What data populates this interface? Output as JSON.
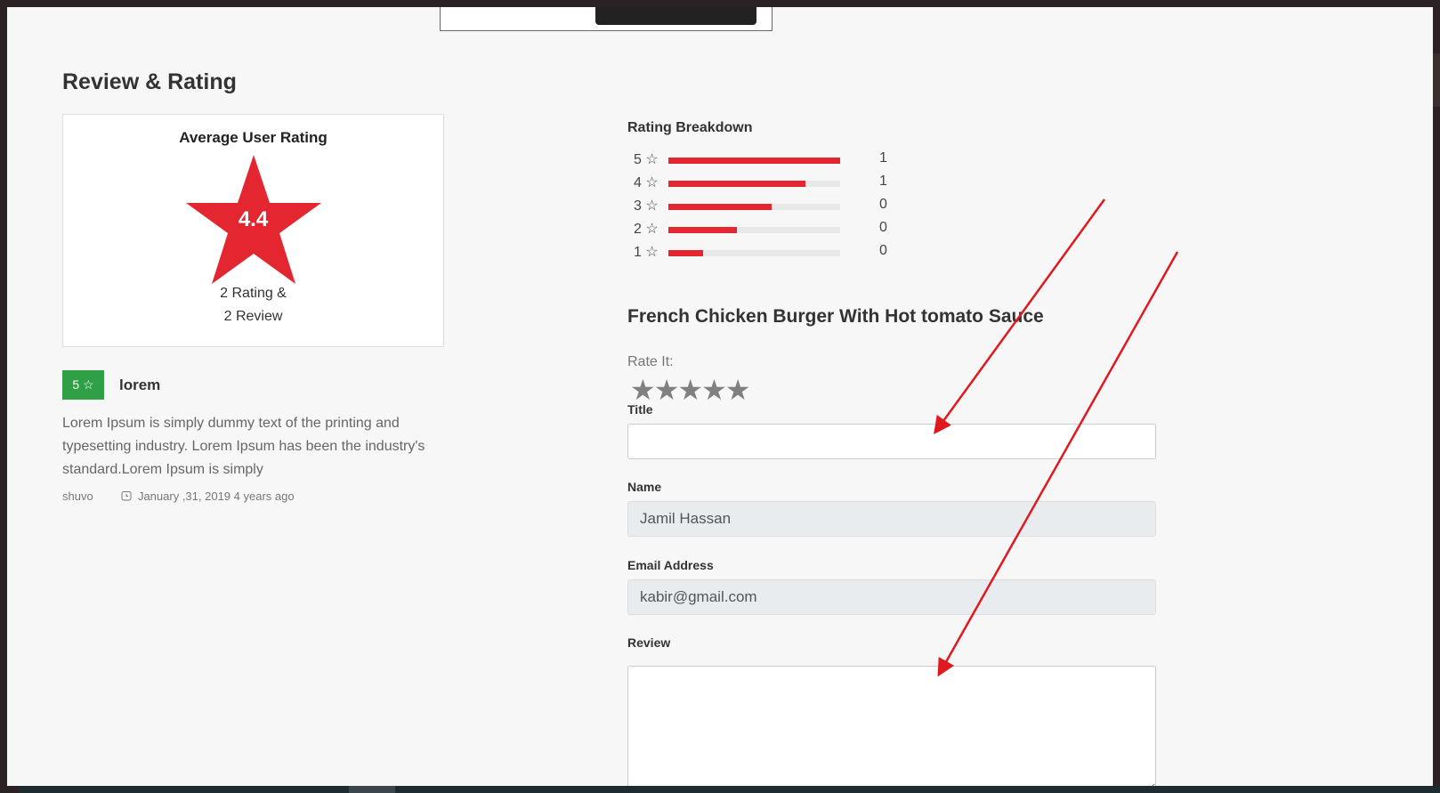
{
  "section": {
    "title": "Review & Rating"
  },
  "average": {
    "title": "Average User Rating",
    "value": "4.4",
    "count_line1": "2 Rating &",
    "count_line2": "2 Review",
    "star_color": "#e3262f"
  },
  "review": {
    "score": "5 ☆",
    "title": "lorem",
    "body": "Lorem Ipsum is simply dummy text of the printing and typesetting industry. Lorem Ipsum has been the industry's standard.Lorem Ipsum is simply",
    "author": "shuvo",
    "date": "January ,31, 2019 4 years ago",
    "badge_color": "#2fa045"
  },
  "breakdown": {
    "title": "Rating Breakdown",
    "rows": [
      {
        "label": "5 ☆",
        "fill": 1.0,
        "count": "1"
      },
      {
        "label": "4 ☆",
        "fill": 0.8,
        "count": "1"
      },
      {
        "label": "3 ☆",
        "fill": 0.6,
        "count": "0"
      },
      {
        "label": "2 ☆",
        "fill": 0.4,
        "count": "0"
      },
      {
        "label": "1 ☆",
        "fill": 0.2,
        "count": "0"
      }
    ],
    "bar_color": "#e3262f"
  },
  "form": {
    "product_title": "French Chicken Burger With Hot tomato Sauce",
    "rate_label": "Rate It:",
    "stars": [
      "★",
      "★",
      "★",
      "★",
      "★"
    ],
    "title_label": "Title",
    "title_value": "",
    "name_label": "Name",
    "name_value": "Jamil Hassan",
    "email_label": "Email Address",
    "email_value": "kabir@gmail.com",
    "review_label": "Review",
    "review_value": ""
  },
  "annotation": {
    "arrow_color": "#e0191f"
  }
}
